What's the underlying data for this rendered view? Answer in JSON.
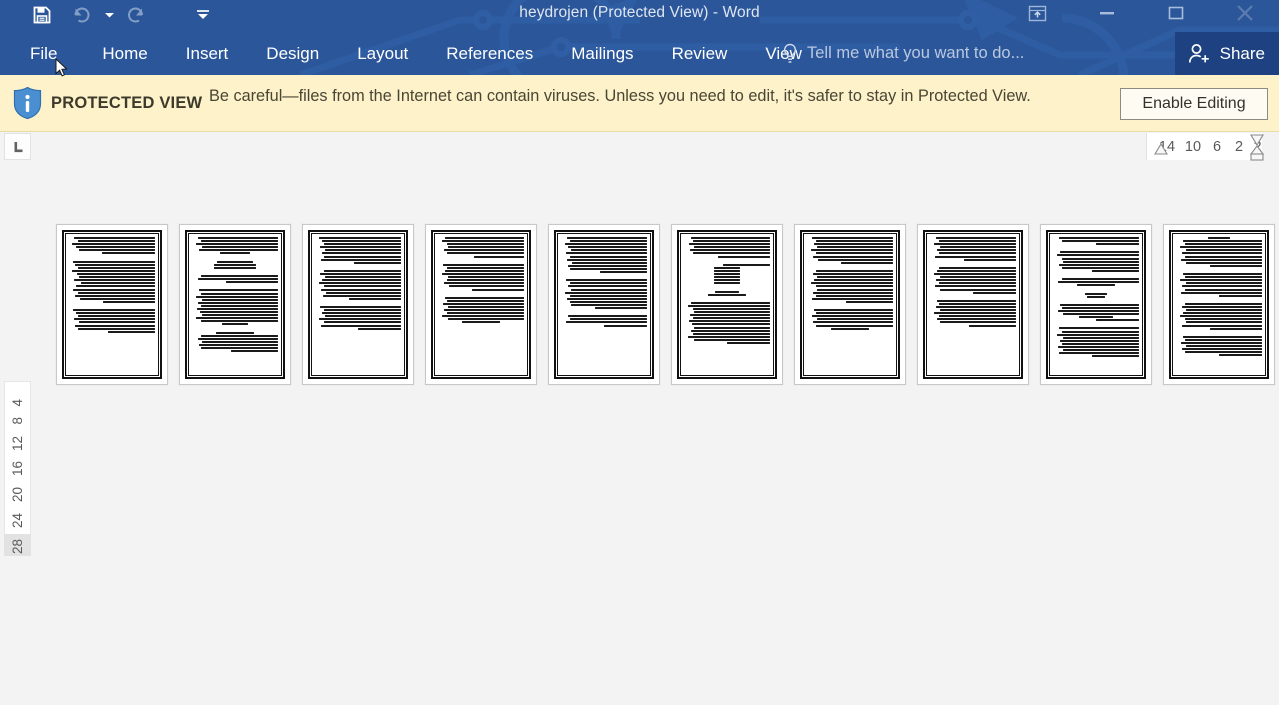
{
  "window": {
    "title": "heydrojen (Protected View) - Word",
    "controls": [
      {
        "name": "ribbon-display-options",
        "label": "Ribbon Display Options"
      },
      {
        "name": "minimize",
        "label": "Minimize"
      },
      {
        "name": "restore",
        "label": "Restore Down"
      },
      {
        "name": "close",
        "label": "Close"
      }
    ]
  },
  "quick_access": {
    "items": [
      {
        "name": "save",
        "label": "Save",
        "enabled": true
      },
      {
        "name": "undo",
        "label": "Undo",
        "enabled": false
      },
      {
        "name": "undo-dropdown",
        "label": "Undo options",
        "enabled": false
      },
      {
        "name": "redo",
        "label": "Redo",
        "enabled": false
      },
      {
        "name": "customize",
        "label": "Customize Quick Access Toolbar",
        "enabled": true
      }
    ]
  },
  "ribbon": {
    "tabs": [
      {
        "label": "File"
      },
      {
        "label": "Home"
      },
      {
        "label": "Insert"
      },
      {
        "label": "Design"
      },
      {
        "label": "Layout"
      },
      {
        "label": "References"
      },
      {
        "label": "Mailings"
      },
      {
        "label": "Review"
      },
      {
        "label": "View"
      }
    ],
    "tell_me": "Tell me what you want to do...",
    "share_label": "Share"
  },
  "protected_view": {
    "badge": "PROTECTED VIEW",
    "message": "Be careful—files from the Internet can contain viruses. Unless you need to edit, it's safer to stay in Protected View.",
    "button": "Enable Editing"
  },
  "rulers": {
    "horizontal_ticks": [
      "14",
      "10",
      "6",
      "2",
      "2"
    ],
    "vertical_ticks": [
      "4",
      "8",
      "12",
      "16",
      "20",
      "24",
      "28"
    ]
  },
  "colors": {
    "ribbon_blue": "#2b579a",
    "share_blue": "#1e4281",
    "banner_yellow": "#fdf2ca",
    "workspace_gray": "#f3f3f3",
    "page_white": "#ffffff"
  },
  "document": {
    "view_mode": "multiple-pages",
    "page_count": 10,
    "pages": [
      {
        "number": 1,
        "lines": [
          0.94,
          0.9,
          0.96,
          0.92,
          0.88,
          0.62,
          0,
          0.95,
          0.93,
          0.9,
          0.96,
          0.91,
          0.88,
          0.94,
          0.86,
          0.92,
          0.95,
          0.9,
          0.93,
          0.87,
          0.6,
          0,
          0.95,
          0.92,
          0.9,
          0.94,
          0.88,
          0.93,
          0.9,
          0.55
        ]
      },
      {
        "number": 2,
        "lines": [
          0.93,
          0.9,
          0.95,
          0.88,
          0.92,
          0.35,
          0,
          0.42,
          0.48,
          0.48,
          0,
          0.9,
          0.93,
          0.6,
          0,
          0.92,
          0.9,
          0.95,
          0.88,
          0.93,
          0.9,
          0.94,
          0.91,
          0.88,
          0.95,
          0.9,
          0.3,
          0,
          0.44,
          0.9,
          0.93,
          0.88,
          0.92,
          0.9,
          0.55
        ]
      },
      {
        "number": 3,
        "lines": [
          0.95,
          0.92,
          0.9,
          0.94,
          0.88,
          0.92,
          0.9,
          0.93,
          0.55,
          0,
          0.9,
          0.94,
          0.88,
          0.92,
          0.95,
          0.9,
          0.93,
          0.87,
          0.91,
          0.6,
          0,
          0.94,
          0.9,
          0.92,
          0.88,
          0.95,
          0.9,
          0.93,
          0.5
        ]
      },
      {
        "number": 4,
        "lines": [
          0.92,
          0.95,
          0.9,
          0.88,
          0.93,
          0.9,
          0.58,
          0,
          0.94,
          0.9,
          0.92,
          0.95,
          0.88,
          0.9,
          0.93,
          0.87,
          0.6,
          0,
          0.92,
          0.9,
          0.94,
          0.88,
          0.93,
          0.9,
          0.95,
          0.88,
          0.45
        ]
      },
      {
        "number": 5,
        "lines": [
          0.93,
          0.9,
          0.95,
          0.92,
          0.88,
          0.94,
          0.9,
          0.93,
          0.87,
          0.92,
          0.9,
          0.55,
          0,
          0.94,
          0.9,
          0.92,
          0.88,
          0.95,
          0.9,
          0.93,
          0.9,
          0.88,
          0.6,
          0,
          0.92,
          0.9,
          0.94,
          0.5
        ]
      },
      {
        "number": 6,
        "lines": [
          0.92,
          0.9,
          0.94,
          0.88,
          0.93,
          0.9,
          0.6,
          0,
          0.55,
          0.3,
          0.3,
          0.3,
          0.3,
          0.3,
          0.3,
          0,
          0.28,
          0.45,
          0,
          0.92,
          0.95,
          0.9,
          0.88,
          0.93,
          0.9,
          0.94,
          0.91,
          0.88,
          0.92,
          0.9,
          0.95,
          0.88,
          0.5
        ]
      },
      {
        "number": 7,
        "lines": [
          0.94,
          0.9,
          0.92,
          0.88,
          0.95,
          0.9,
          0.93,
          0.87,
          0.6,
          0,
          0.9,
          0.93,
          0.88,
          0.92,
          0.95,
          0.9,
          0.88,
          0.93,
          0.9,
          0.94,
          0.55,
          0,
          0.92,
          0.9,
          0.94,
          0.88,
          0.93,
          0.9,
          0.45
        ]
      },
      {
        "number": 8,
        "lines": [
          0.93,
          0.9,
          0.95,
          0.88,
          0.92,
          0.9,
          0.94,
          0.6,
          0,
          0.9,
          0.92,
          0.95,
          0.88,
          0.93,
          0.9,
          0.94,
          0.88,
          0.5,
          0,
          0.92,
          0.9,
          0.93,
          0.88,
          0.95,
          0.9,
          0.92,
          0.88,
          0.55
        ]
      },
      {
        "number": 9,
        "lines": [
          0.93,
          0.9,
          0.5,
          0,
          0.92,
          0.95,
          0.9,
          0.88,
          0.93,
          0.9,
          0.55,
          0,
          0.9,
          0.94,
          0.45,
          0,
          0.25,
          0.2,
          0,
          0.92,
          0.9,
          0.94,
          0.88,
          0.4,
          0.5,
          0,
          0.93,
          0.9,
          0.95,
          0.88,
          0.92,
          0.9,
          0.94,
          0.88,
          0.93,
          0.55
        ]
      },
      {
        "number": 10,
        "lines": [
          0.25,
          0.92,
          0.9,
          0.95,
          0.88,
          0.93,
          0.9,
          0.94,
          0.88,
          0.6,
          0,
          0.92,
          0.9,
          0.95,
          0.88,
          0.93,
          0.9,
          0.94,
          0.5,
          0,
          0.9,
          0.93,
          0.88,
          0.92,
          0.95,
          0.9,
          0.88,
          0.93,
          0.6,
          0,
          0.92,
          0.9,
          0.94,
          0.88,
          0.93,
          0.9,
          0.5
        ]
      }
    ]
  }
}
